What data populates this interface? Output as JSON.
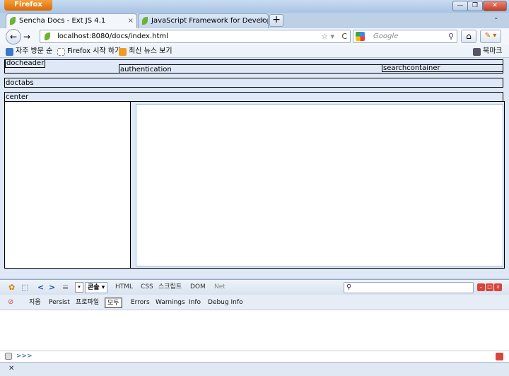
{
  "window": {
    "menu_label": "Firefox",
    "min_glyph": "—",
    "max_glyph": "❐",
    "close_glyph": "✕"
  },
  "tabs": [
    {
      "label": "Sencha Docs - Ext JS 4.1"
    },
    {
      "label": "JavaScript Framework for Developin..."
    }
  ],
  "tab_close_glyph": "×",
  "new_tab_glyph": "+",
  "tab_list_glyph": "⌄",
  "nav": {
    "back_glyph": "←",
    "forward_glyph": "→",
    "url": "localhost:8080/docs/index.html",
    "star_glyph": "☆ ▾",
    "reload_glyph": "C",
    "search_placeholder": "Google",
    "search_glyph": "⚲",
    "home_glyph": "⌂",
    "addon_glyph": "✎ ▾"
  },
  "bookmarks": {
    "items": [
      {
        "label": "자주 방문 순"
      },
      {
        "label": "Firefox 시작 하기"
      },
      {
        "label": "최신 뉴스 보기"
      }
    ],
    "bookmarks_menu": "북마크"
  },
  "page": {
    "docheader": "docheader",
    "authentication": "authentication",
    "searchcontainer": "searchcontainer",
    "doctabs": "doctabs",
    "center": "center"
  },
  "firebug": {
    "icons": {
      "bug": "✿",
      "inspect": "⬚",
      "back": "<",
      "forward": ">",
      "list": "≡",
      "drop": "▾",
      "search": "⚲",
      "min": "–",
      "detach": "□",
      "close": "x",
      "clear_console": "⊘"
    },
    "tabs": [
      {
        "label": "콘솔 ▾"
      },
      {
        "label": "HTML"
      },
      {
        "label": "CSS"
      },
      {
        "label": "스크립트"
      },
      {
        "label": "DOM"
      },
      {
        "label": "Net"
      }
    ],
    "console_buttons": [
      {
        "label": "지움"
      },
      {
        "label": "Persist"
      },
      {
        "label": "프로파일"
      },
      {
        "label": "모두"
      },
      {
        "label": "Errors"
      },
      {
        "label": "Warnings"
      },
      {
        "label": "Info"
      },
      {
        "label": "Debug Info"
      }
    ],
    "prompt": ">>>"
  },
  "status": {
    "close_glyph": "✕"
  },
  "colors": {
    "firefox_orange": "#e07a10",
    "sencha_leaf": "#6bb337",
    "ext_bg": "#dfe8f6",
    "firebug_red": "#d9453a"
  }
}
